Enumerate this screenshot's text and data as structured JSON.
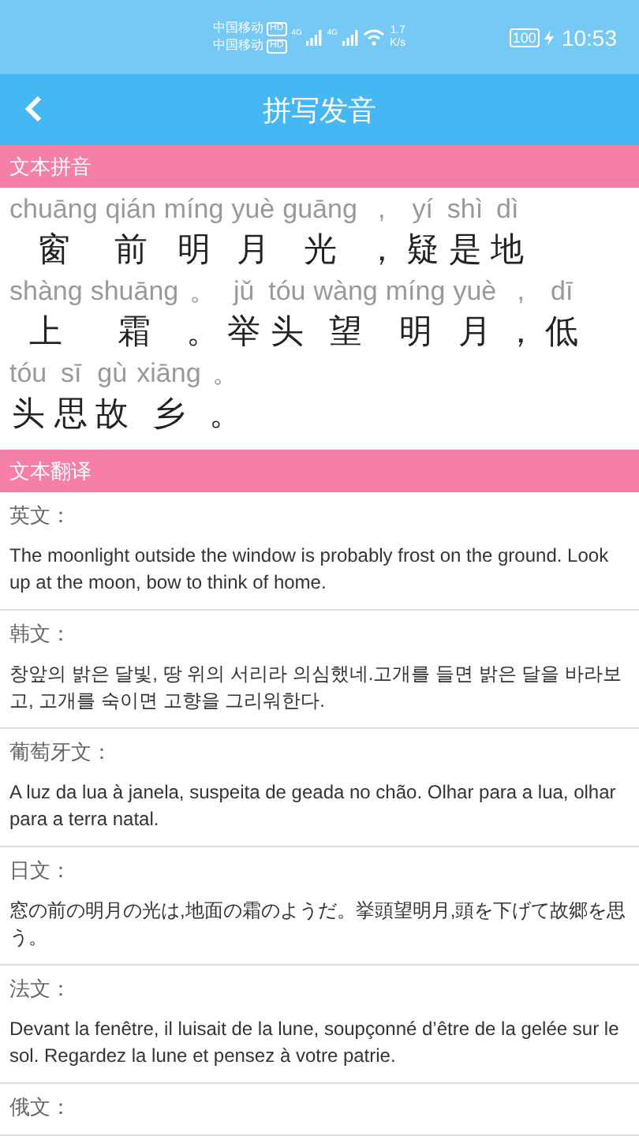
{
  "status_bar": {
    "carrier_1": "中国移动",
    "carrier_2": "中国移动",
    "hd_badge_1": "HD",
    "hd_badge_2": "HD",
    "network_1": "4G",
    "network_2": "4G",
    "speed_value": "1.7",
    "speed_unit": "K/s",
    "battery": "100",
    "time": "10:53"
  },
  "header": {
    "title": "拼写发音"
  },
  "pinyin_section": {
    "title": "文本拼音",
    "lines": [
      [
        {
          "pinyin": "chuāng",
          "hanzi": "窗"
        },
        {
          "pinyin": "qián",
          "hanzi": "前"
        },
        {
          "pinyin": "míng",
          "hanzi": "明"
        },
        {
          "pinyin": "yuè",
          "hanzi": "月"
        },
        {
          "pinyin": "guāng",
          "hanzi": "光"
        },
        {
          "pinyin": ",",
          "hanzi": "，"
        },
        {
          "pinyin": "yí",
          "hanzi": "疑"
        },
        {
          "pinyin": "shì",
          "hanzi": "是"
        },
        {
          "pinyin": "dì",
          "hanzi": "地"
        }
      ],
      [
        {
          "pinyin": "shàng",
          "hanzi": "上"
        },
        {
          "pinyin": "shuāng",
          "hanzi": "霜"
        },
        {
          "pinyin": "。",
          "hanzi": "。"
        },
        {
          "pinyin": "jǔ",
          "hanzi": "举"
        },
        {
          "pinyin": "tóu",
          "hanzi": "头"
        },
        {
          "pinyin": "wàng",
          "hanzi": "望"
        },
        {
          "pinyin": "míng",
          "hanzi": "明"
        },
        {
          "pinyin": "yuè",
          "hanzi": "月"
        },
        {
          "pinyin": ",",
          "hanzi": "，"
        },
        {
          "pinyin": "dī",
          "hanzi": "低"
        }
      ],
      [
        {
          "pinyin": "tóu",
          "hanzi": "头"
        },
        {
          "pinyin": "sī",
          "hanzi": "思"
        },
        {
          "pinyin": "gù",
          "hanzi": "故"
        },
        {
          "pinyin": "xiāng",
          "hanzi": "乡"
        },
        {
          "pinyin": "。",
          "hanzi": "。"
        }
      ]
    ]
  },
  "translation_section": {
    "title": "文本翻译",
    "items": [
      {
        "language": "英文：",
        "text": "The moonlight outside the window is probably frost on the ground. Look up at the moon, bow to think of home."
      },
      {
        "language": "韩文：",
        "text": "창앞의 밝은 달빛, 땅 위의 서리라 의심했네.고개를 들면 밝은 달을 바라보고, 고개를 숙이면 고향을 그리워한다."
      },
      {
        "language": "葡萄牙文：",
        "text": "A luz da lua à janela, suspeita de geada no chão. Olhar para a lua, olhar para a terra natal."
      },
      {
        "language": "日文：",
        "text": "窓の前の明月の光は,地面の霜のようだ。挙頭望明月,頭を下げて故郷を思う。"
      },
      {
        "language": "法文：",
        "text": "Devant la fenêtre, il luisait de la lune, soupçonné d’être de la gelée sur le sol. Regardez la lune et pensez à votre patrie."
      },
      {
        "language": "俄文："
      }
    ]
  }
}
